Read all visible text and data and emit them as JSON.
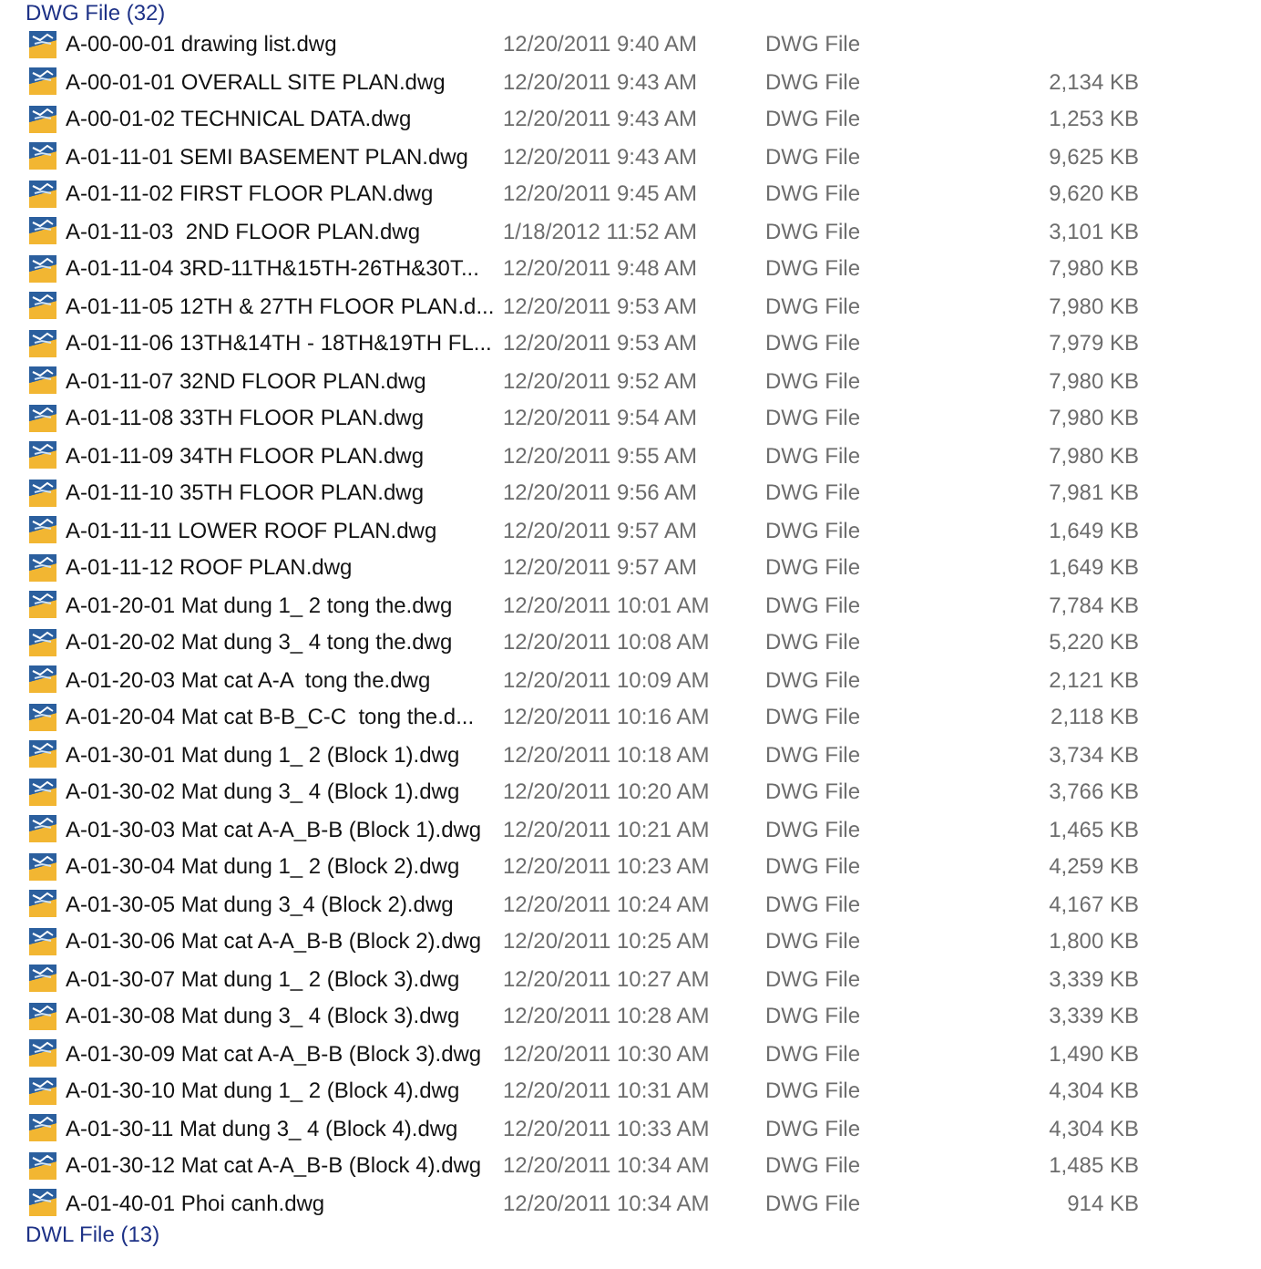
{
  "group_header": "DWG File (32)",
  "files": [
    {
      "name": "A-00-00-01 drawing list.dwg",
      "date": "12/20/2011 9:40 AM",
      "type": "DWG File"
    },
    {
      "name": "A-00-01-01 OVERALL SITE PLAN.dwg",
      "date": "12/20/2011 9:43 AM",
      "type": "DWG File",
      "size": "2,134 KB"
    },
    {
      "name": "A-00-01-02 TECHNICAL DATA.dwg",
      "date": "12/20/2011 9:43 AM",
      "type": "DWG File",
      "size": "1,253 KB"
    },
    {
      "name": "A-01-11-01 SEMI BASEMENT PLAN.dwg",
      "date": "12/20/2011 9:43 AM",
      "type": "DWG File",
      "size": "9,625 KB"
    },
    {
      "name": "A-01-11-02 FIRST FLOOR PLAN.dwg",
      "date": "12/20/2011 9:45 AM",
      "type": "DWG File",
      "size": "9,620 KB"
    },
    {
      "name": "A-01-11-03  2ND FLOOR PLAN.dwg",
      "date": "1/18/2012 11:52 AM",
      "type": "DWG File",
      "size": "3,101 KB"
    },
    {
      "name": "A-01-11-04 3RD-11TH&15TH-26TH&30T...",
      "date": "12/20/2011 9:48 AM",
      "type": "DWG File",
      "size": "7,980 KB"
    },
    {
      "name": "A-01-11-05 12TH & 27TH FLOOR PLAN.d...",
      "date": "12/20/2011 9:53 AM",
      "type": "DWG File",
      "size": "7,980 KB"
    },
    {
      "name": "A-01-11-06 13TH&14TH - 18TH&19TH FL...",
      "date": "12/20/2011 9:53 AM",
      "type": "DWG File",
      "size": "7,979 KB"
    },
    {
      "name": "A-01-11-07 32ND FLOOR PLAN.dwg",
      "date": "12/20/2011 9:52 AM",
      "type": "DWG File",
      "size": "7,980 KB"
    },
    {
      "name": "A-01-11-08 33TH FLOOR PLAN.dwg",
      "date": "12/20/2011 9:54 AM",
      "type": "DWG File",
      "size": "7,980 KB"
    },
    {
      "name": "A-01-11-09 34TH FLOOR PLAN.dwg",
      "date": "12/20/2011 9:55 AM",
      "type": "DWG File",
      "size": "7,980 KB"
    },
    {
      "name": "A-01-11-10 35TH FLOOR PLAN.dwg",
      "date": "12/20/2011 9:56 AM",
      "type": "DWG File",
      "size": "7,981 KB"
    },
    {
      "name": "A-01-11-11 LOWER ROOF PLAN.dwg",
      "date": "12/20/2011 9:57 AM",
      "type": "DWG File",
      "size": "1,649 KB"
    },
    {
      "name": "A-01-11-12 ROOF PLAN.dwg",
      "date": "12/20/2011 9:57 AM",
      "type": "DWG File",
      "size": "1,649 KB"
    },
    {
      "name": "A-01-20-01 Mat dung 1_ 2 tong the.dwg",
      "date": "12/20/2011 10:01 AM",
      "type": "DWG File",
      "size": "7,784 KB"
    },
    {
      "name": "A-01-20-02 Mat dung 3_ 4 tong the.dwg",
      "date": "12/20/2011 10:08 AM",
      "type": "DWG File",
      "size": "5,220 KB"
    },
    {
      "name": "A-01-20-03 Mat cat A-A  tong the.dwg",
      "date": "12/20/2011 10:09 AM",
      "type": "DWG File",
      "size": "2,121 KB"
    },
    {
      "name": "A-01-20-04 Mat cat B-B_C-C  tong the.d...",
      "date": "12/20/2011 10:16 AM",
      "type": "DWG File",
      "size": "2,118 KB"
    },
    {
      "name": "A-01-30-01 Mat dung 1_ 2 (Block 1).dwg",
      "date": "12/20/2011 10:18 AM",
      "type": "DWG File",
      "size": "3,734 KB"
    },
    {
      "name": "A-01-30-02 Mat dung 3_ 4 (Block 1).dwg",
      "date": "12/20/2011 10:20 AM",
      "type": "DWG File",
      "size": "3,766 KB"
    },
    {
      "name": "A-01-30-03 Mat cat A-A_B-B (Block 1).dwg",
      "date": "12/20/2011 10:21 AM",
      "type": "DWG File",
      "size": "1,465 KB"
    },
    {
      "name": "A-01-30-04 Mat dung 1_ 2 (Block 2).dwg",
      "date": "12/20/2011 10:23 AM",
      "type": "DWG File",
      "size": "4,259 KB"
    },
    {
      "name": "A-01-30-05 Mat dung 3_4 (Block 2).dwg",
      "date": "12/20/2011 10:24 AM",
      "type": "DWG File",
      "size": "4,167 KB"
    },
    {
      "name": "A-01-30-06 Mat cat A-A_B-B (Block 2).dwg",
      "date": "12/20/2011 10:25 AM",
      "type": "DWG File",
      "size": "1,800 KB"
    },
    {
      "name": "A-01-30-07 Mat dung 1_ 2 (Block 3).dwg",
      "date": "12/20/2011 10:27 AM",
      "type": "DWG File",
      "size": "3,339 KB"
    },
    {
      "name": "A-01-30-08 Mat dung 3_ 4 (Block 3).dwg",
      "date": "12/20/2011 10:28 AM",
      "type": "DWG File",
      "size": "3,339 KB"
    },
    {
      "name": "A-01-30-09 Mat cat A-A_B-B (Block 3).dwg",
      "date": "12/20/2011 10:30 AM",
      "type": "DWG File",
      "size": "1,490 KB"
    },
    {
      "name": "A-01-30-10 Mat dung 1_ 2 (Block 4).dwg",
      "date": "12/20/2011 10:31 AM",
      "type": "DWG File",
      "size": "4,304 KB"
    },
    {
      "name": "A-01-30-11 Mat dung 3_ 4 (Block 4).dwg",
      "date": "12/20/2011 10:33 AM",
      "type": "DWG File",
      "size": "4,304 KB"
    },
    {
      "name": "A-01-30-12 Mat cat A-A_B-B (Block 4).dwg",
      "date": "12/20/2011 10:34 AM",
      "type": "DWG File",
      "size": "1,485 KB"
    },
    {
      "name": "A-01-40-01 Phoi canh.dwg",
      "date": "12/20/2011 10:34 AM",
      "type": "DWG File",
      "size": "914 KB"
    }
  ],
  "next_group_header": "DWL File (13)"
}
